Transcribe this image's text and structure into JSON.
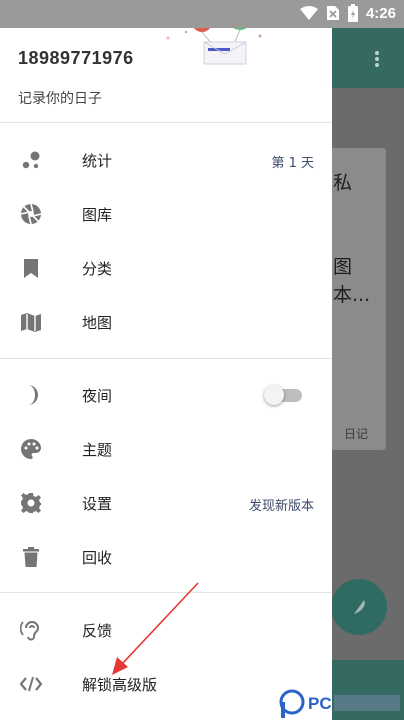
{
  "status_bar": {
    "time": "4:26"
  },
  "drawer": {
    "phone": "18989771976",
    "subtitle": "记录你的日子",
    "items": [
      {
        "label": "统计",
        "value": "第 1 天"
      },
      {
        "label": "图库"
      },
      {
        "label": "分类"
      },
      {
        "label": "地图"
      },
      {
        "label": "夜间",
        "toggle_on": false
      },
      {
        "label": "主题"
      },
      {
        "label": "设置",
        "value": "发现新版本"
      },
      {
        "label": "回收"
      },
      {
        "label": "反馈"
      },
      {
        "label": "解锁高级版"
      }
    ]
  },
  "background": {
    "card_text_1": "私",
    "card_text_2": "图",
    "card_text_3": "本...",
    "card_meta": "日记"
  },
  "watermark": {
    "text": "PC"
  },
  "colors": {
    "accent": "#356a63",
    "annotation": "#e53935"
  }
}
